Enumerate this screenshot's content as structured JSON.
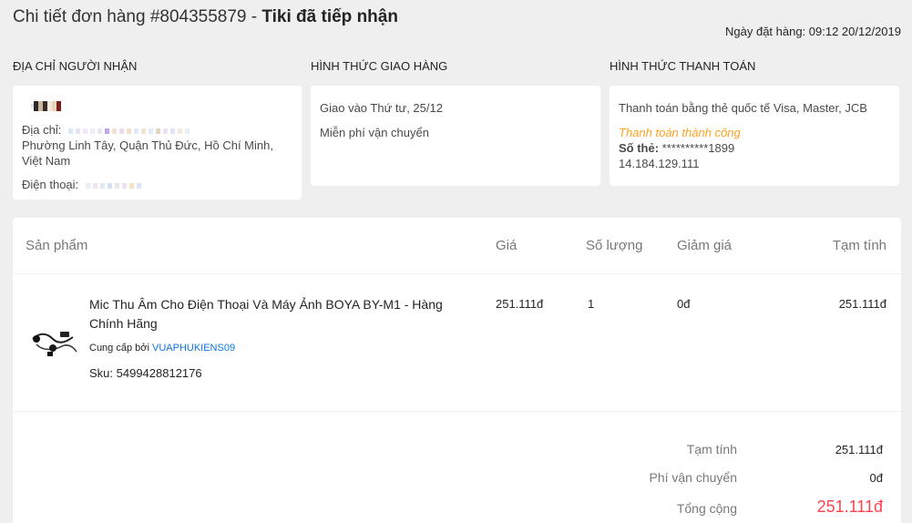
{
  "header": {
    "title_prefix": "Chi tiết đơn hàng #804355879 - ",
    "status": "Tiki đã tiếp nhận",
    "order_date": "Ngày đặt hàng: 09:12 20/12/2019"
  },
  "recipient": {
    "heading": "Địa chỉ người nhận",
    "address_label": "Địa chỉ:",
    "address_visible": "Phường Linh Tây, Quận Thủ Đức, Hồ Chí Minh, Việt Nam",
    "phone_label": "Điện thoại:"
  },
  "shipping": {
    "heading": "Hình thức giao hàng",
    "delivery": "Giao vào Thứ tư, 25/12",
    "fee": "Miễn phí vận chuyển"
  },
  "payment": {
    "heading": "Hình thức thanh toán",
    "method": "Thanh toán bằng thẻ quốc tế Visa, Master, JCB",
    "status": "Thanh toán thành công",
    "card_label": "Số thẻ:",
    "card_number": " **********1899",
    "ip": "14.184.129.111"
  },
  "table": {
    "headers": {
      "product": "Sản phẩm",
      "price": "Giá",
      "qty": "Số lượng",
      "discount": "Giảm giá",
      "subtotal": "Tạm tính"
    },
    "item": {
      "name": "Mic Thu Âm Cho Điện Thoại Và Máy Ảnh BOYA BY-M1 - Hàng Chính Hãng",
      "seller_prefix": "Cung cấp bởi ",
      "seller": "VUAPHUKIENS09",
      "sku": "Sku: 5499428812176",
      "price": "251.111đ",
      "qty": "1",
      "discount": "0đ",
      "subtotal": "251.111đ"
    }
  },
  "summary": {
    "subtotal_label": "Tạm tính",
    "subtotal": "251.111đ",
    "shipping_label": "Phí vận chuyển",
    "shipping": "0đ",
    "total_label": "Tổng cộng",
    "total": "251.111đ"
  },
  "colors": {
    "accent_link": "#0b74e5",
    "success": "#fda223",
    "total": "#ff424e"
  }
}
